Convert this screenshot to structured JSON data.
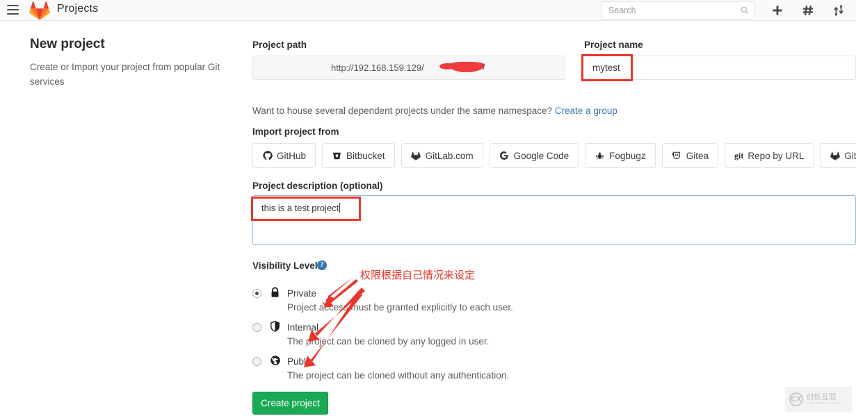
{
  "navbar": {
    "brand_title": "Projects",
    "search_placeholder": "Search",
    "search_value": "",
    "icons": {
      "menu": "hamburger-icon",
      "logo": "gitlab-logo-icon",
      "search": "search-icon",
      "plus": "plus-icon",
      "issues": "hash-icon",
      "merge_requests": "merge-request-icon"
    }
  },
  "intro": {
    "title": "New project",
    "subtitle": "Create or Import your project from popular Git services"
  },
  "form": {
    "path_label": "Project path",
    "path_value": "http://192.168.159.129/",
    "path_suffix": "/",
    "name_label": "Project name",
    "name_value": "mytest",
    "hint_text": "Want to house several dependent projects under the same namespace?",
    "hint_link": "Create a group",
    "import_label": "Import project from",
    "import_options": [
      {
        "label": "GitHub",
        "icon": "github-icon"
      },
      {
        "label": "Bitbucket",
        "icon": "bitbucket-icon"
      },
      {
        "label": "GitLab.com",
        "icon": "gitlab-icon"
      },
      {
        "label": "Google Code",
        "icon": "google-icon"
      },
      {
        "label": "Fogbugz",
        "icon": "fogbugz-bug-icon"
      },
      {
        "label": "Gitea",
        "icon": "gitea-icon"
      },
      {
        "label": "Repo by URL",
        "icon": "git-icon"
      },
      {
        "label": "GitLab export",
        "icon": "gitlab-icon"
      }
    ],
    "description_label": "Project description (optional)",
    "description_value": "this is a test project",
    "visibility_label": "Visibility Level",
    "visibility_help": "?",
    "visibility_options": [
      {
        "name": "Private",
        "icon": "lock-icon",
        "description": "Project access must be granted explicitly to each user.",
        "selected": true
      },
      {
        "name": "Internal",
        "icon": "shield-icon",
        "description": "The project can be cloned by any logged in user.",
        "selected": false
      },
      {
        "name": "Public",
        "icon": "globe-icon",
        "description": "The project can be cloned without any authentication.",
        "selected": false
      }
    ],
    "submit_label": "Create project"
  },
  "annotations": {
    "note_text": "权限根据自己情况来设定",
    "note_color": "#e8362c",
    "highlight_color": "#e8362c",
    "arrow_count": 3
  },
  "watermark": {
    "cn": "创新互联",
    "en": "CHUANGXIN HULIAN",
    "mark": "CX"
  }
}
